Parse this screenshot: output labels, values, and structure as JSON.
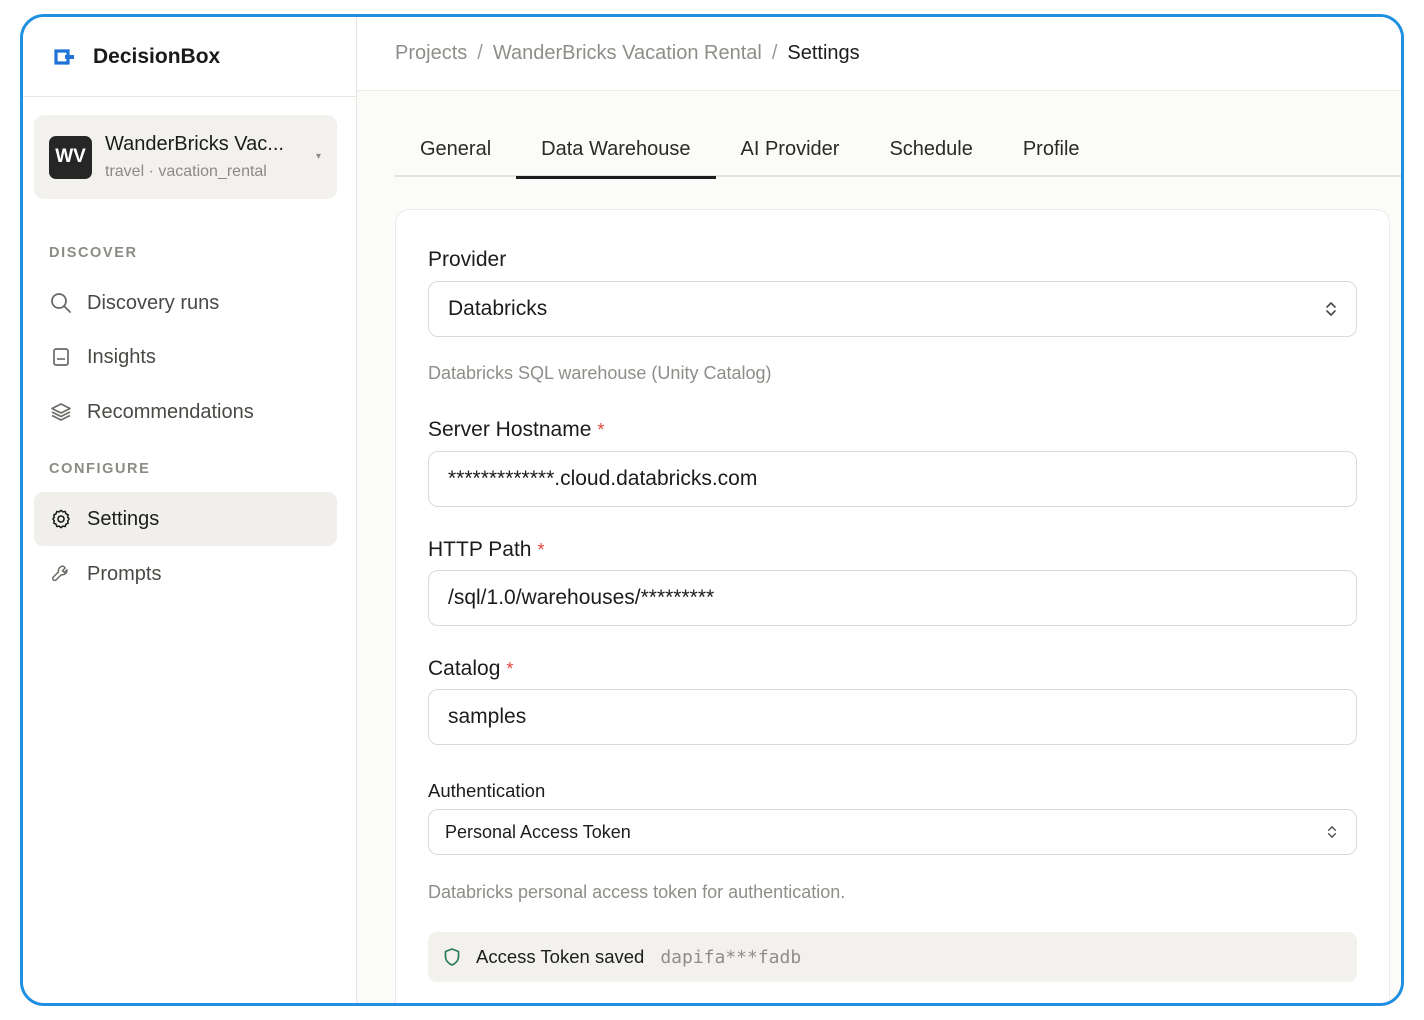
{
  "app": {
    "name": "DecisionBox"
  },
  "project": {
    "initials": "WV",
    "name": "WanderBricks Vac...",
    "subtitle": "travel · vacation_rental"
  },
  "sidebar": {
    "discover_label": "DISCOVER",
    "configure_label": "CONFIGURE",
    "items": [
      {
        "label": "Discovery runs",
        "icon": "search-icon"
      },
      {
        "label": "Insights",
        "icon": "document-icon"
      },
      {
        "label": "Recommendations",
        "icon": "layers-icon"
      },
      {
        "label": "Settings",
        "icon": "gear-icon",
        "active": true
      },
      {
        "label": "Prompts",
        "icon": "wrench-icon"
      }
    ]
  },
  "breadcrumb": [
    "Projects",
    "WanderBricks Vacation Rental",
    "Settings"
  ],
  "tabs": [
    {
      "label": "General"
    },
    {
      "label": "Data Warehouse",
      "active": true
    },
    {
      "label": "AI Provider"
    },
    {
      "label": "Schedule"
    },
    {
      "label": "Profile"
    }
  ],
  "form": {
    "provider_label": "Provider",
    "provider_value": "Databricks",
    "provider_help": "Databricks SQL warehouse (Unity Catalog)",
    "hostname_label": "Server Hostname",
    "hostname_value": "*************.cloud.databricks.com",
    "http_path_label": "HTTP Path",
    "http_path_value": "/sql/1.0/warehouses/*********",
    "catalog_label": "Catalog",
    "catalog_value": "samples",
    "required_mark": "*",
    "auth_label": "Authentication",
    "auth_value": "Personal Access Token",
    "auth_help": "Databricks personal access token for authentication.",
    "token_status": "Access Token saved",
    "token_masked": "dapifa***fadb"
  },
  "colors": {
    "frame_border": "#1f8fe0",
    "brand_accent": "#1f73d8",
    "required": "#e0483e",
    "token_shield": "#2f7a55"
  }
}
